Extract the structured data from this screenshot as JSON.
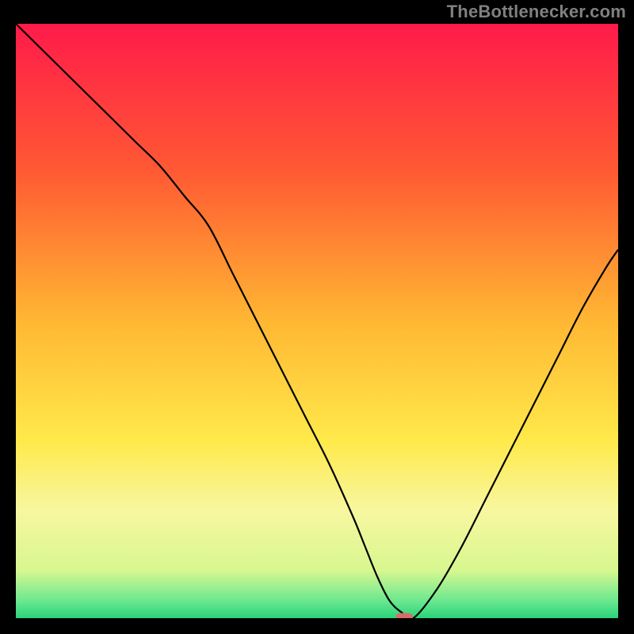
{
  "attribution": "TheBottlenecker.com",
  "chart_data": {
    "type": "line",
    "title": "",
    "xlabel": "",
    "ylabel": "",
    "xlim": [
      0,
      100
    ],
    "ylim": [
      0,
      100
    ],
    "grid": false,
    "legend": false,
    "gradient_stops": [
      {
        "offset": 0,
        "color": "#ff1a4a"
      },
      {
        "offset": 25,
        "color": "#ff5a33"
      },
      {
        "offset": 50,
        "color": "#ffb733"
      },
      {
        "offset": 70,
        "color": "#ffe94a"
      },
      {
        "offset": 82,
        "color": "#f7f7a0"
      },
      {
        "offset": 92,
        "color": "#d7f78f"
      },
      {
        "offset": 97,
        "color": "#6de890"
      },
      {
        "offset": 100,
        "color": "#2ad37a"
      }
    ],
    "series": [
      {
        "name": "bottleneck-curve",
        "color": "#000000",
        "stroke_width": 2.2,
        "x": [
          0,
          4,
          8,
          12,
          16,
          20,
          24,
          28,
          32,
          36,
          40,
          44,
          48,
          52,
          56,
          58,
          60,
          62,
          64,
          66,
          70,
          74,
          78,
          82,
          86,
          90,
          94,
          98,
          100
        ],
        "y": [
          100,
          96,
          92,
          88,
          84,
          80,
          76,
          71,
          66,
          58,
          50,
          42,
          34,
          26,
          17,
          12,
          7,
          3,
          1,
          0,
          5,
          12,
          20,
          28,
          36,
          44,
          52,
          59,
          62
        ]
      }
    ],
    "marker": {
      "name": "optimal-point",
      "shape": "rounded-rect",
      "color": "#d96a6a",
      "x": 64.5,
      "y": 0.2,
      "width_pct": 2.8,
      "height_pct": 1.3
    }
  }
}
